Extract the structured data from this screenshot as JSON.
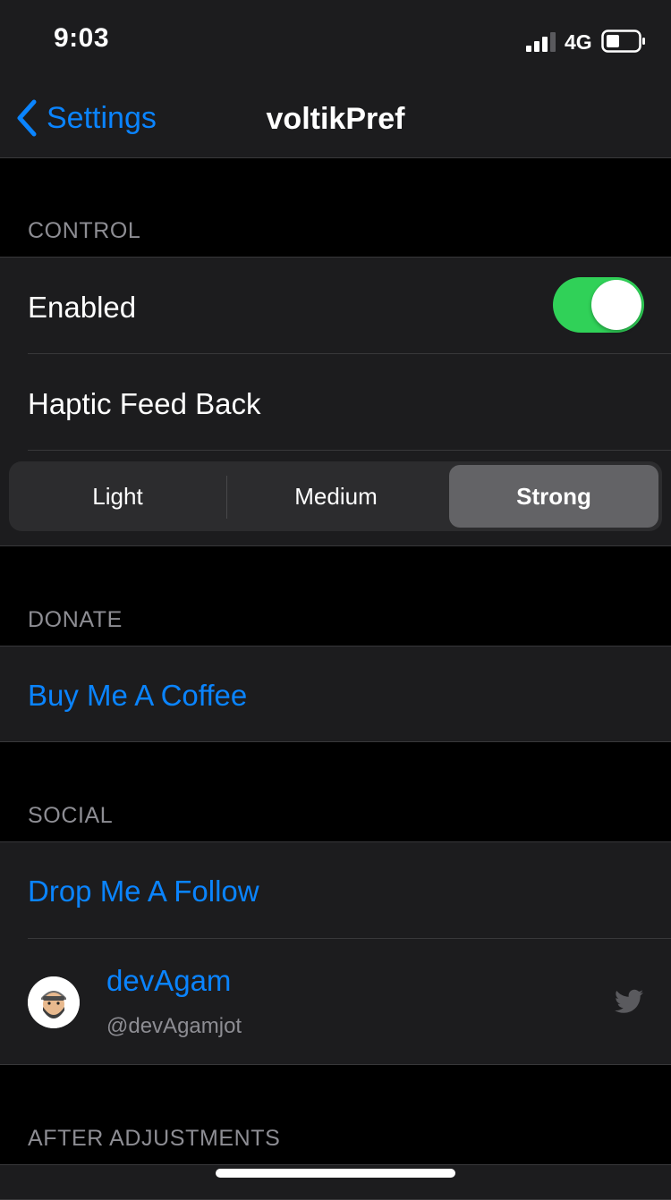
{
  "status_bar": {
    "time": "9:03",
    "network": "4G",
    "icons": [
      "signal-icon",
      "battery-icon"
    ]
  },
  "nav": {
    "back_label": "Settings",
    "title": "voltikPref"
  },
  "control": {
    "header": "CONTROL",
    "enabled_label": "Enabled",
    "enabled_on": true,
    "haptic_label": "Haptic Feed Back",
    "segments": [
      "Light",
      "Medium",
      "Strong"
    ],
    "selected_segment": "Strong"
  },
  "donate": {
    "header": "DONATE",
    "link": "Buy Me A Coffee"
  },
  "social": {
    "header": "SOCIAL",
    "link": "Drop Me A Follow",
    "twitter_name": "devAgam",
    "twitter_handle": "@devAgamjot",
    "icon": "twitter-icon"
  },
  "after": {
    "header": "AFTER ADJUSTMENTS"
  },
  "colors": {
    "accent": "#0a84ff",
    "toggle_on": "#30d158",
    "cell_background": "#1c1c1e",
    "page_background": "#000000"
  }
}
